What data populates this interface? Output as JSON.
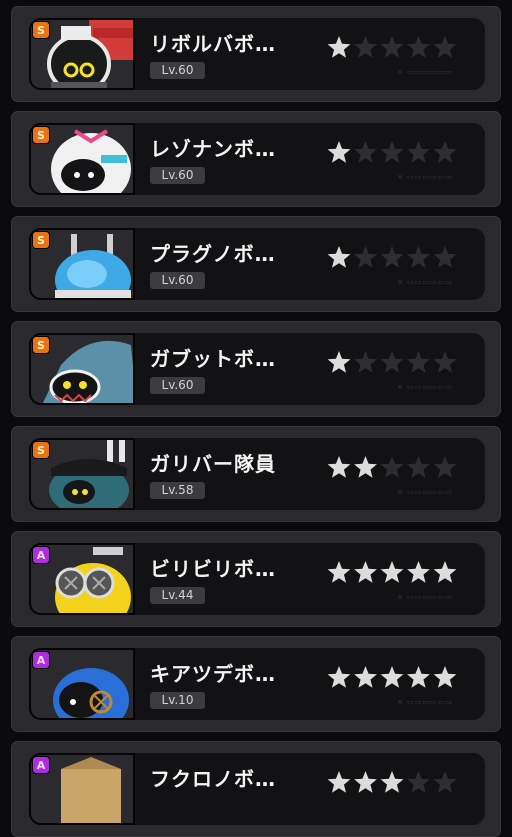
{
  "units": [
    {
      "name": "リボルバボ…",
      "level": "Lv.60",
      "rank": "S",
      "stars": 1,
      "max_stars": 5,
      "tag": "× ▭▭▭▭▭▭",
      "portrait": "revolver-bot"
    },
    {
      "name": "レゾナンボ…",
      "level": "Lv.60",
      "rank": "S",
      "stars": 1,
      "max_stars": 5,
      "tag": "× ▭▭▭▭▭▭",
      "portrait": "resonan-bot"
    },
    {
      "name": "プラグノボ…",
      "level": "Lv.60",
      "rank": "S",
      "stars": 1,
      "max_stars": 5,
      "tag": "× ▭▭▭▭▭▭",
      "portrait": "plug-bot"
    },
    {
      "name": "ガブットボ…",
      "level": "Lv.60",
      "rank": "S",
      "stars": 1,
      "max_stars": 5,
      "tag": "× ▭▭▭▭▭▭",
      "portrait": "shark-bot"
    },
    {
      "name": "ガリバー隊員",
      "level": "Lv.58",
      "rank": "S",
      "stars": 2,
      "max_stars": 5,
      "tag": "× ▭▭▭▭▭▭",
      "portrait": "gulliver-member"
    },
    {
      "name": "ビリビリボ…",
      "level": "Lv.44",
      "rank": "A",
      "stars": 5,
      "max_stars": 5,
      "tag": "× ▭▭▭▭▭▭",
      "portrait": "biribiri-bot"
    },
    {
      "name": "キアツデボ…",
      "level": "Lv.10",
      "rank": "A",
      "stars": 5,
      "max_stars": 5,
      "tag": "× ▭▭▭▭▭▭",
      "portrait": "kiatsude-bot"
    },
    {
      "name": "フクロノボ…",
      "level": "",
      "rank": "A",
      "stars": 3,
      "max_stars": 5,
      "tag": "",
      "portrait": "fukurono-bot"
    }
  ],
  "colors": {
    "star_on": "#dcdcdc",
    "star_off": "#2e2e32",
    "rank_S": "#e87316",
    "rank_A": "#b02ce0"
  }
}
